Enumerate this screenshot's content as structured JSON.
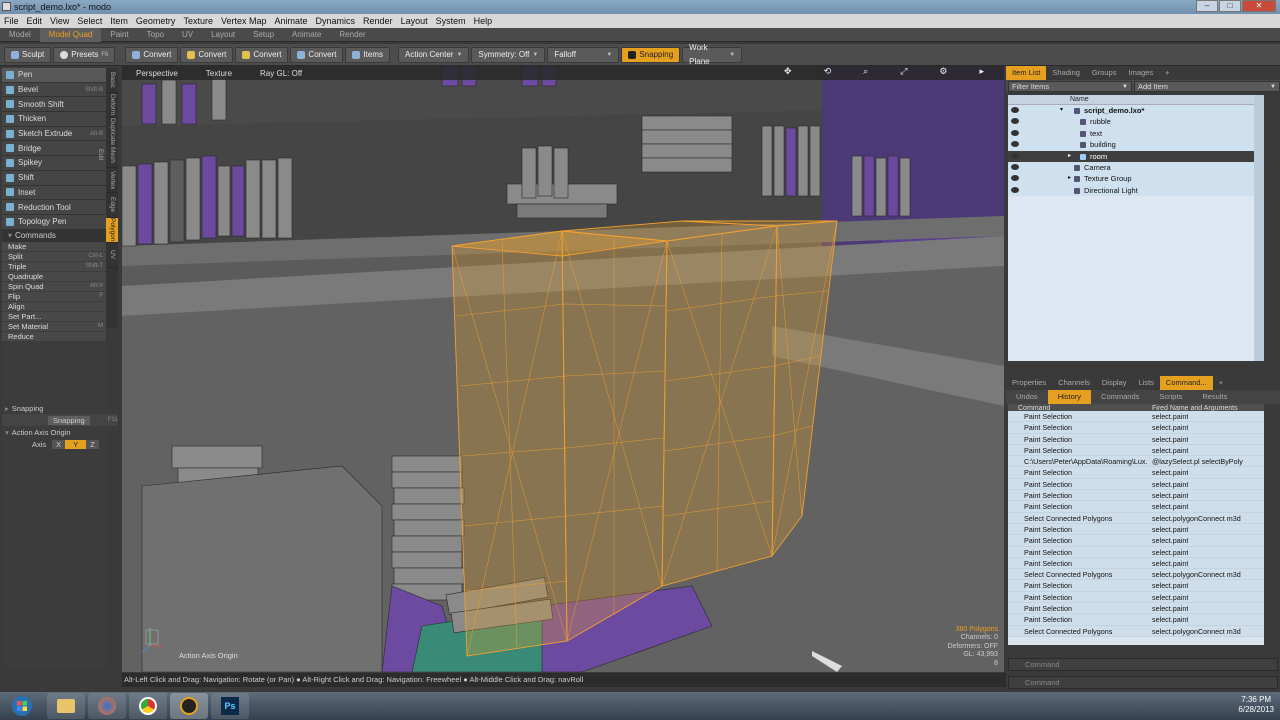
{
  "window": {
    "title": "script_demo.lxo* - modo"
  },
  "menu": [
    "File",
    "Edit",
    "View",
    "Select",
    "Item",
    "Geometry",
    "Texture",
    "Vertex Map",
    "Animate",
    "Dynamics",
    "Render",
    "Layout",
    "System",
    "Help"
  ],
  "layout_tabs": [
    "Model",
    "Model Quad",
    "Paint",
    "Topo",
    "UV",
    "Layout",
    "Setup",
    "Animate",
    "Render"
  ],
  "toolbar": {
    "sculpt": "Sculpt",
    "presets": "Presets",
    "convert": "Convert",
    "items": "Items",
    "action_center": "Action Center",
    "symmetry": "Symmetry: Off",
    "falloff": "Falloff",
    "snapping": "Snapping",
    "work_plane": "Work Plane"
  },
  "tools": [
    {
      "label": "Pen",
      "key": ""
    },
    {
      "label": "Bevel",
      "key": "Shift-B"
    },
    {
      "label": "Smooth Shift",
      "key": ""
    },
    {
      "label": "Thicken",
      "key": ""
    },
    {
      "label": "Sketch Extrude",
      "key": "Alt-B"
    },
    {
      "label": "Bridge",
      "key": ""
    },
    {
      "label": "Spikey",
      "key": ""
    },
    {
      "label": "Shift",
      "key": ""
    },
    {
      "label": "Inset",
      "key": ""
    },
    {
      "label": "Reduction Tool",
      "key": ""
    },
    {
      "label": "Topology Pen",
      "key": ""
    }
  ],
  "commands_header": "Commands",
  "commands": [
    {
      "label": "Make",
      "key": ""
    },
    {
      "label": "Split",
      "key": "Ctrl-L"
    },
    {
      "label": "Triple",
      "key": "Shift-T"
    },
    {
      "label": "Quadruple",
      "key": ""
    },
    {
      "label": "Spin Quad",
      "key": "Alt-V"
    },
    {
      "label": "Flip",
      "key": "F"
    },
    {
      "label": "Align",
      "key": ""
    },
    {
      "label": "Set Part...",
      "key": ""
    },
    {
      "label": "Set Material",
      "key": "M"
    },
    {
      "label": "Reduce",
      "key": ""
    }
  ],
  "vtabs": [
    "Basic",
    "Deform",
    "Duplicate",
    "Mesh Edit",
    "Vertex",
    "Edge",
    "Polygon",
    "UV"
  ],
  "snapping": {
    "header": "Snapping",
    "button": "Snapping",
    "key": "F11",
    "axis_header": "Action Axis Origin",
    "axis_label": "Axis",
    "axes": [
      "X",
      "Y",
      "Z"
    ]
  },
  "viewport": {
    "view": "Perspective",
    "shading": "Texture",
    "ray": "Ray GL: Off",
    "axis_label": "Action Axis Origin",
    "stats": {
      "polygons": "360 Polygons",
      "channels": "Channels: 0",
      "deformers": "Deformers: OFF",
      "gl": "GL: 43,993",
      "num": "8"
    }
  },
  "status": "Alt-Left Click and Drag: Navigation: Rotate (or Pan) ● Alt-Right Click and Drag: Navigation: Freewheel ● Alt-Middle Click and Drag: navRoll",
  "right_tabs": [
    "Item List",
    "Shading",
    "Groups",
    "Images",
    "+"
  ],
  "filter": {
    "label": "Filter Items",
    "add": "Add Item"
  },
  "item_header": "Name",
  "items": [
    {
      "name": "script_demo.lxo*",
      "indent": 0,
      "sel": false
    },
    {
      "name": "rubble",
      "indent": 1,
      "sel": false
    },
    {
      "name": "text",
      "indent": 1,
      "sel": false
    },
    {
      "name": "building",
      "indent": 1,
      "sel": false
    },
    {
      "name": "room",
      "indent": 1,
      "sel": true
    },
    {
      "name": "Camera",
      "indent": 0,
      "sel": false
    },
    {
      "name": "Texture Group",
      "indent": 0,
      "sel": false
    },
    {
      "name": "Directional Light",
      "indent": 0,
      "sel": false
    }
  ],
  "lower_tabs": [
    "Properties",
    "Channels",
    "Display",
    "Lists",
    "Command...",
    "+"
  ],
  "cmd_tabs": [
    "Undos",
    "History",
    "Commands",
    "Scripts",
    "Results"
  ],
  "cmd_headers": {
    "c1": "Command",
    "c2": "Fired Name and Arguments"
  },
  "history": [
    [
      "Paint Selection",
      "select.paint"
    ],
    [
      "Paint Selection",
      "select.paint"
    ],
    [
      "Paint Selection",
      "select.paint"
    ],
    [
      "Paint Selection",
      "select.paint"
    ],
    [
      "C:\\Users\\Peter\\AppData\\Roaming\\Lux...",
      "@lazySelect.pl selectByPoly"
    ],
    [
      "Paint Selection",
      "select.paint"
    ],
    [
      "Paint Selection",
      "select.paint"
    ],
    [
      "Paint Selection",
      "select.paint"
    ],
    [
      "Paint Selection",
      "select.paint"
    ],
    [
      "Select Connected Polygons",
      "select.polygonConnect m3d"
    ],
    [
      "Paint Selection",
      "select.paint"
    ],
    [
      "Paint Selection",
      "select.paint"
    ],
    [
      "Paint Selection",
      "select.paint"
    ],
    [
      "Paint Selection",
      "select.paint"
    ],
    [
      "Select Connected Polygons",
      "select.polygonConnect m3d"
    ],
    [
      "Paint Selection",
      "select.paint"
    ],
    [
      "Paint Selection",
      "select.paint"
    ],
    [
      "Paint Selection",
      "select.paint"
    ],
    [
      "Paint Selection",
      "select.paint"
    ],
    [
      "Select Connected Polygons",
      "select.polygonConnect m3d"
    ]
  ],
  "command_input": "Command",
  "clock": {
    "time": "7:36 PM",
    "date": "6/28/2013"
  },
  "colors": {
    "accent": "#e6a020",
    "selection": "#f0a030",
    "purple": "#6b4aa0"
  }
}
